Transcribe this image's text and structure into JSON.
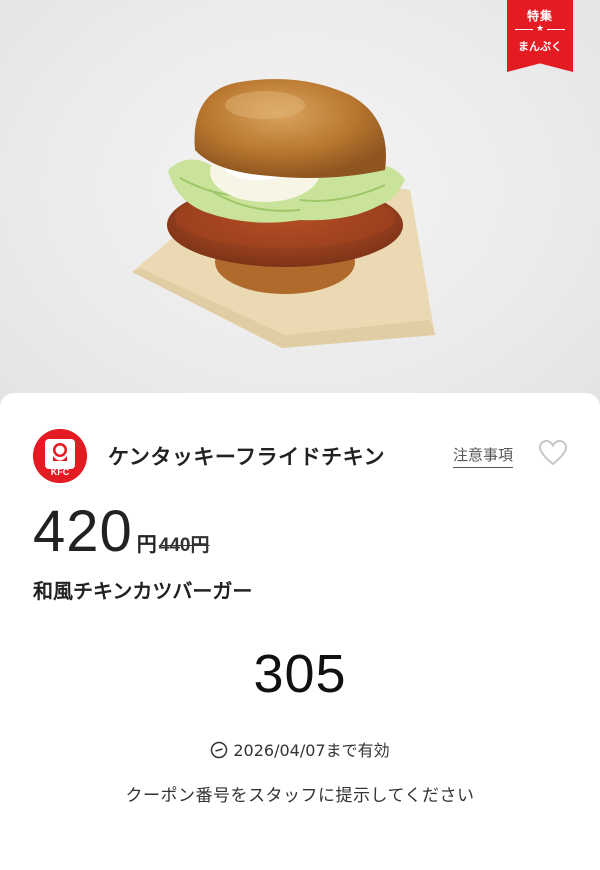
{
  "ribbon": {
    "top_label": "特集",
    "bottom_label": "まんぷく"
  },
  "store": {
    "name": "ケンタッキーフライドチキン",
    "logo_text": "KFC"
  },
  "actions": {
    "notes_label": "注意事項"
  },
  "price": {
    "current": "420",
    "unit": "円",
    "original": "440円"
  },
  "product": {
    "name": "和風チキンカツバーガー"
  },
  "coupon": {
    "code": "305",
    "expiry": "2026/04/07まで有効",
    "instruction": "クーポン番号をスタッフに提示してください"
  },
  "colors": {
    "brand_red": "#e41b23",
    "card_bg": "#ffffff",
    "photo_bg": "#ebebeb"
  },
  "icons": {
    "favorite": "heart-outline-icon",
    "expiry": "clock-icon",
    "ribbon_star": "star-icon"
  }
}
